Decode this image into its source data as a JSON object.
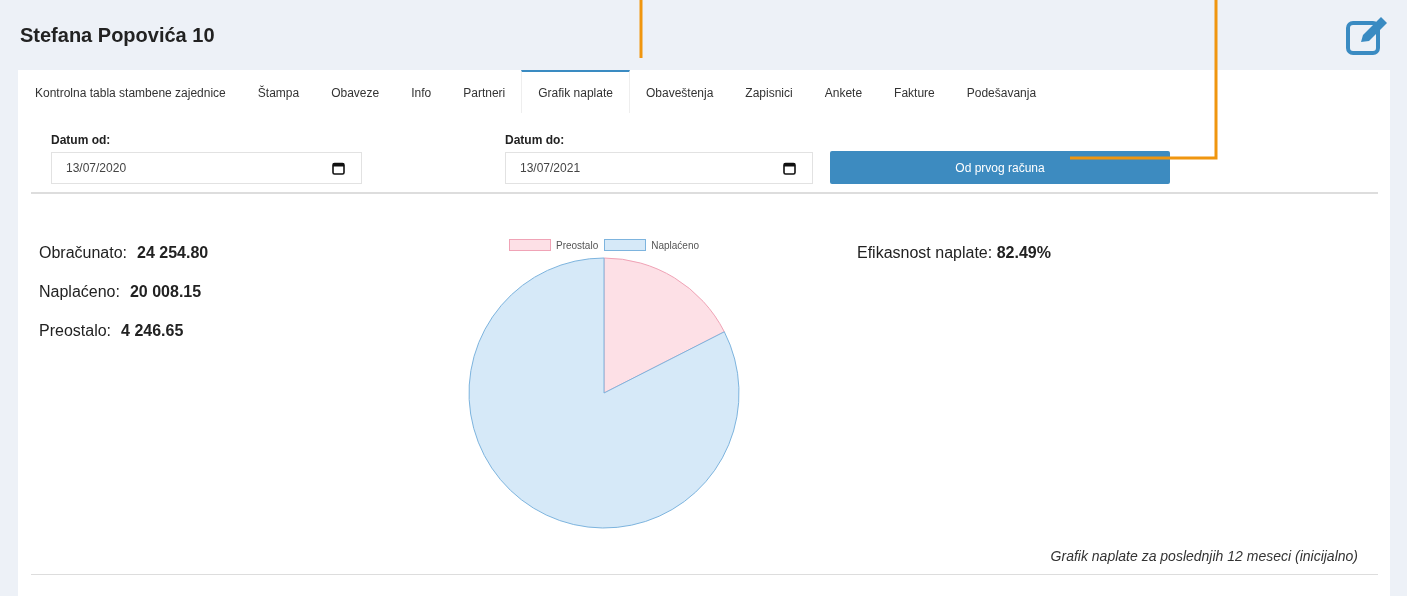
{
  "header": {
    "title": "Stefana Popovića 10"
  },
  "tabs": [
    {
      "label": "Kontrolna tabla stambene zajednice",
      "selected": false
    },
    {
      "label": "Štampa",
      "selected": false
    },
    {
      "label": "Obaveze",
      "selected": false
    },
    {
      "label": "Info",
      "selected": false
    },
    {
      "label": "Partneri",
      "selected": false
    },
    {
      "label": "Grafik naplate",
      "selected": true
    },
    {
      "label": "Obaveštenja",
      "selected": false
    },
    {
      "label": "Zapisnici",
      "selected": false
    },
    {
      "label": "Ankete",
      "selected": false
    },
    {
      "label": "Fakture",
      "selected": false
    },
    {
      "label": "Podešavanja",
      "selected": false
    }
  ],
  "filters": {
    "date_from": {
      "label": "Datum od:",
      "value": "13/07/2020"
    },
    "date_to": {
      "label": "Datum do:",
      "value": "13/07/2021"
    },
    "button": "Od prvog računa"
  },
  "stats": [
    {
      "label": "Obračunato:",
      "value": "24 254.80"
    },
    {
      "label": "Naplaćeno:",
      "value": "20 008.15"
    },
    {
      "label": "Preostalo:",
      "value": "4 246.65"
    }
  ],
  "chart": {
    "chart_data": {
      "type": "pie",
      "categories": [
        "Preostalo",
        "Naplaćeno"
      ],
      "values": [
        17.51,
        82.49
      ],
      "colors": [
        "#fde0e6",
        "#d6e9f8"
      ],
      "legend": true
    }
  },
  "efficiency": {
    "label": "Efikasnost naplate:",
    "value": "82.49%"
  },
  "caption": "Grafik naplate za poslednjih 12 meseci (inicijalno)"
}
